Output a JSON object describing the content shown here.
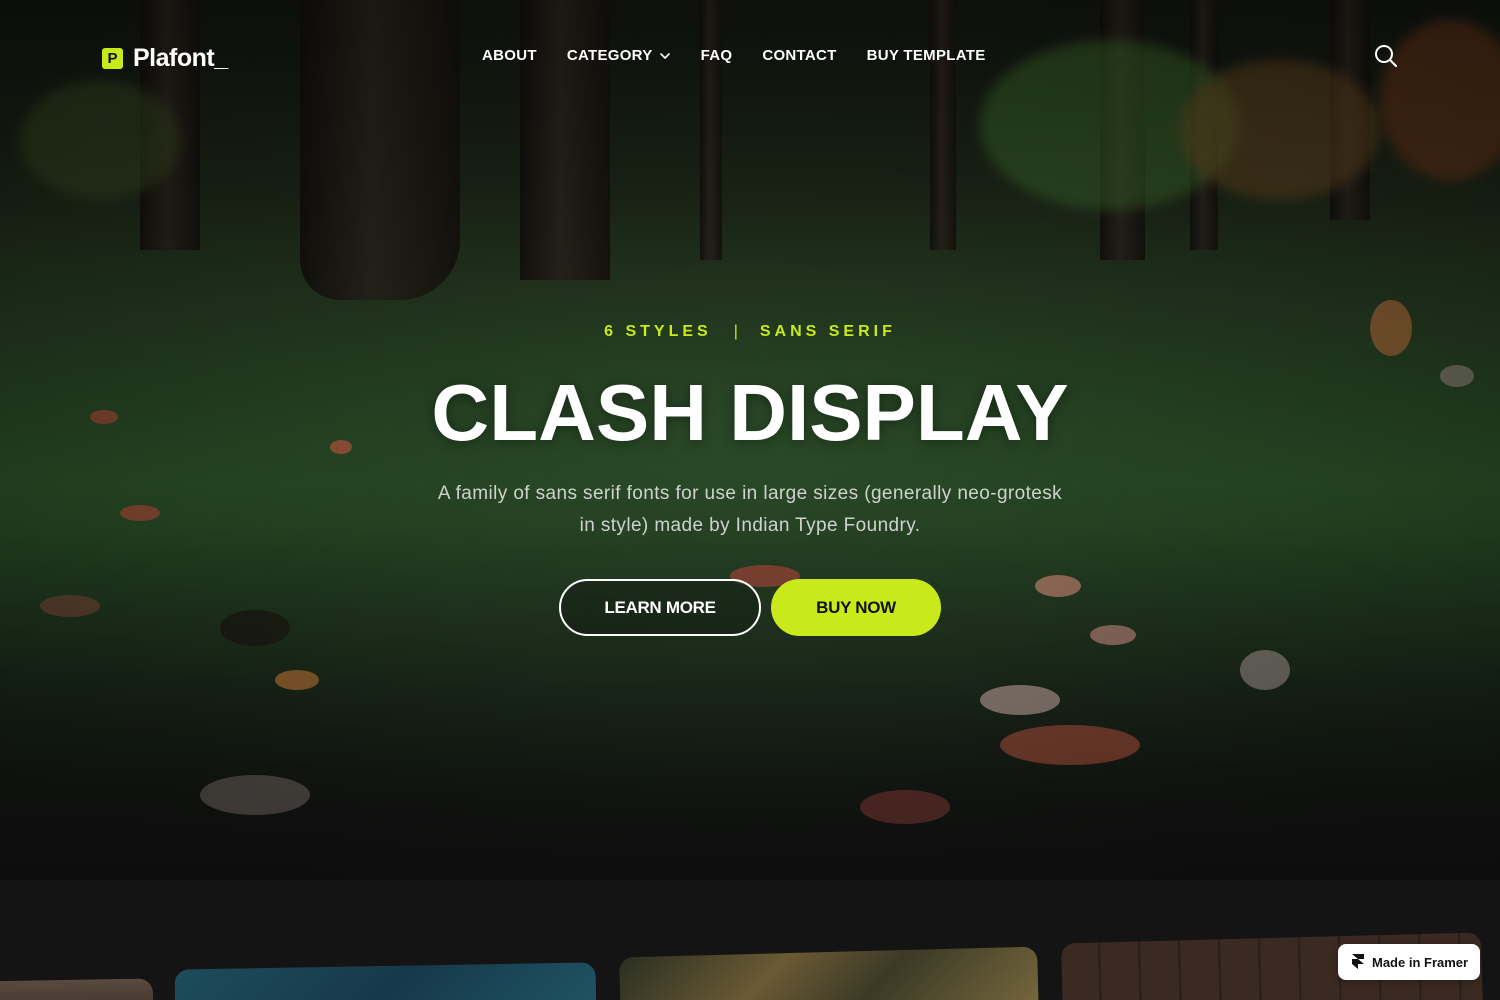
{
  "brand": {
    "logo_letter": "P",
    "name": "Plafont_",
    "accent_color": "#c8ea1a"
  },
  "nav": {
    "items": [
      {
        "label": "ABOUT"
      },
      {
        "label": "CATEGORY",
        "has_dropdown": true
      },
      {
        "label": "FAQ"
      },
      {
        "label": "CONTACT"
      },
      {
        "label": "BUY TEMPLATE"
      }
    ],
    "search_icon": "search-icon"
  },
  "hero": {
    "eyebrow_left": "6 STYLES",
    "eyebrow_separator": "|",
    "eyebrow_right": "SANS SERIF",
    "title": "CLASH DISPLAY",
    "description": "A family of sans serif fonts for use in large sizes (generally neo-grotesk in style) made by Indian Type Foundry.",
    "primary_button": "LEARN MORE",
    "secondary_button": "BUY NOW"
  },
  "badge": {
    "label": "Made in Framer",
    "icon": "framer-icon"
  }
}
